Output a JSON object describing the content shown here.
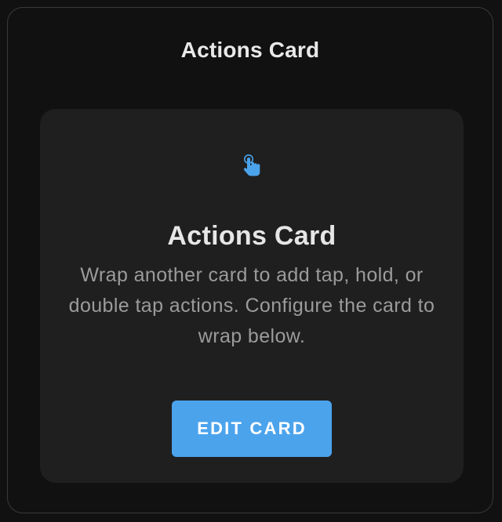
{
  "dialog": {
    "title": "Actions Card"
  },
  "card": {
    "icon": "gesture-tap-icon",
    "title": "Actions Card",
    "description": "Wrap another card to add tap, hold, or double tap actions. Configure the card to wrap below.",
    "button_label": "EDIT CARD"
  },
  "colors": {
    "accent": "#4ba3ec",
    "background": "#111111",
    "card": "#1f1f1f",
    "border": "#3a3a3a"
  }
}
